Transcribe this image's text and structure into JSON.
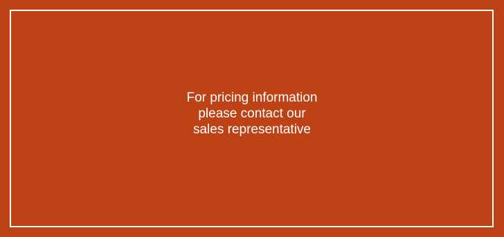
{
  "banner": {
    "message_lines": [
      "For pricing information",
      "please contact our",
      "sales representative"
    ]
  },
  "colors": {
    "background": "#BD4317",
    "border": "#FFFFFF",
    "text": "#FFFFFF"
  }
}
